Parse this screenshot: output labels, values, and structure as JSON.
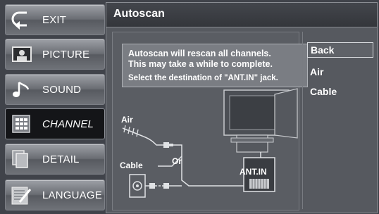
{
  "menu": {
    "items": [
      {
        "label": "EXIT",
        "icon": "exit-arrow-icon"
      },
      {
        "label": "PICTURE",
        "icon": "picture-icon"
      },
      {
        "label": "SOUND",
        "icon": "music-note-icon"
      },
      {
        "label": "CHANNEL",
        "icon": "channel-grid-icon",
        "active": true
      },
      {
        "label": "DETAIL",
        "icon": "detail-pages-icon"
      },
      {
        "label": "LANGUAGE",
        "icon": "language-icon"
      }
    ]
  },
  "panel": {
    "title": "Autoscan",
    "message_line1": "Autoscan will rescan all channels.",
    "message_line2": "This may take a while to complete.",
    "message_line3": "Select the destination of \"ANT.IN\" jack.",
    "diagram": {
      "air_label": "Air",
      "cable_label": "Cable",
      "or_label": "Or",
      "jack_label": "ANT.IN"
    }
  },
  "options": {
    "back": "Back",
    "air": "Air",
    "cable": "Cable",
    "selected": "Back"
  },
  "colors": {
    "background": "#40434a",
    "active_item": "#141518",
    "text": "#ffffff"
  }
}
